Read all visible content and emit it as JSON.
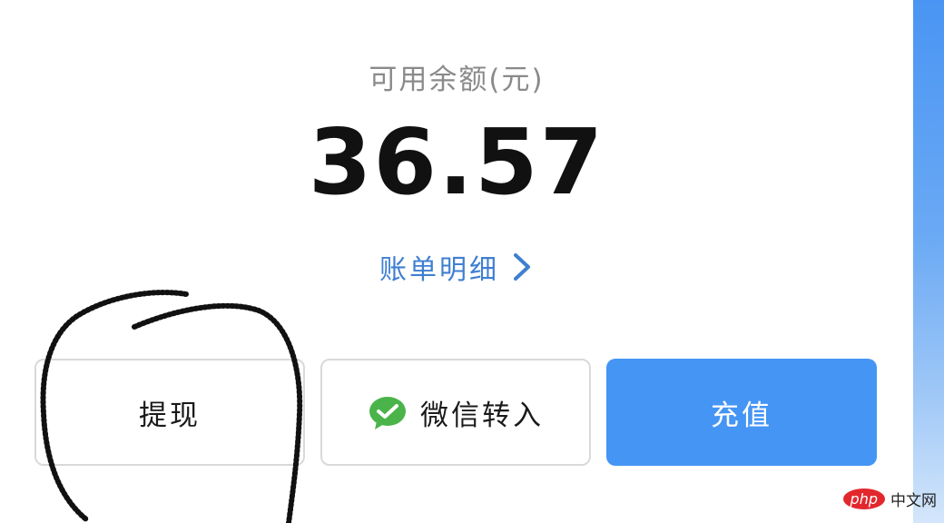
{
  "balance": {
    "label": "可用余额(元)",
    "amount": "36.57"
  },
  "bill_link": {
    "label": "账单明细",
    "icon": "chevron-right-icon"
  },
  "actions": {
    "withdraw_label": "提现",
    "wechat_transfer_label": "微信转入",
    "wechat_icon": "wechat-icon",
    "recharge_label": "充值"
  },
  "watermark": {
    "logo_text": "php",
    "site_text": "中文网"
  },
  "colors": {
    "accent_blue": "#4595f4",
    "link_blue": "#3f7fd0",
    "wechat_green": "#4ab44a",
    "annotation": "#111111"
  }
}
